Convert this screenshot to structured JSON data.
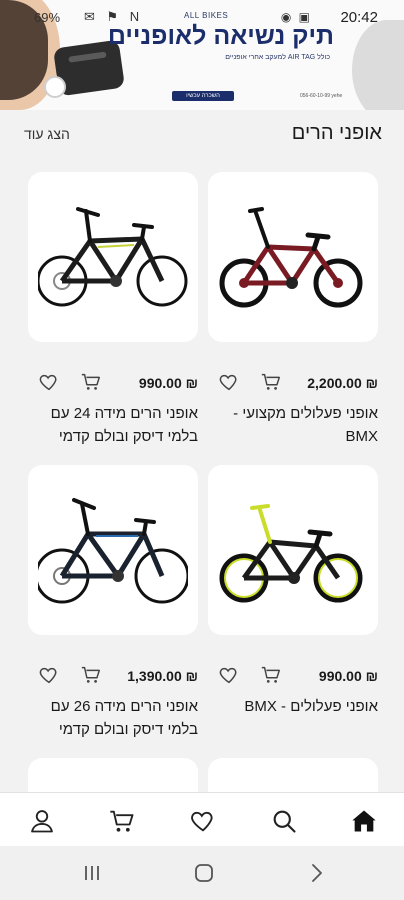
{
  "status_bar": {
    "time": "20:42",
    "battery": "69%"
  },
  "banner": {
    "brand": "ALL BIKES",
    "title": "תיק נשיאה לאופניים",
    "subtitle": "כולל AIR TAG למעקב אחרי אופניים",
    "cta": "השכרה עכשיו",
    "phone": "056-60-10-99 yehe"
  },
  "section": {
    "title": "אופני הרים",
    "show_more": "הצג עוד"
  },
  "products": [
    {
      "price": "₪ 2,200.00",
      "name": "אופני פעלולים מקצועי - BMX",
      "frame_color": "#7a1a22",
      "accent_color": "#111111"
    },
    {
      "price": "₪ 990.00",
      "name": "אופני הרים מידה 24 עם בלמי דיסק ובולם קדמי",
      "frame_color": "#1c1c1c",
      "accent_color": "#c7d13a"
    },
    {
      "price": "₪ 990.00",
      "name": "אופני פעלולים - BMX",
      "frame_color": "#1c1c1c",
      "accent_color": "#c9dd2a"
    },
    {
      "price": "₪ 1,390.00",
      "name": "אופני הרים מידה 26 עם בלמי דיסק ובולם קדמי",
      "frame_color": "#1a2230",
      "accent_color": "#2a6cb0"
    }
  ],
  "icons": {
    "home": "home-icon",
    "search": "search-icon",
    "favorites": "heart-icon",
    "cart": "cart-icon",
    "profile": "user-icon"
  }
}
